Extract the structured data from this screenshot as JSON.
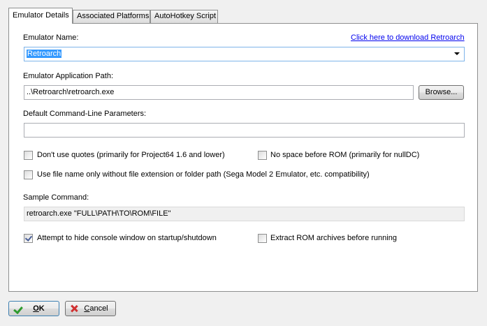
{
  "tabs": [
    {
      "label": "Emulator Details",
      "active": true
    },
    {
      "label": "Associated Platforms",
      "active": false
    },
    {
      "label": "AutoHotkey Script",
      "active": false
    }
  ],
  "emulator_name": {
    "label": "Emulator Name:",
    "value": "Retroarch",
    "download_link": "Click here to download Retroarch"
  },
  "app_path": {
    "label": "Emulator Application Path:",
    "value": "..\\Retroarch\\retroarch.exe",
    "browse_button": "Browse..."
  },
  "params": {
    "label": "Default Command-Line Parameters:",
    "value": ""
  },
  "options": {
    "no_quotes": {
      "label": "Don't use quotes (primarily for Project64 1.6 and lower)",
      "checked": false
    },
    "no_space": {
      "label": "No space before ROM (primarily for nullDC)",
      "checked": false
    },
    "file_name_only": {
      "label": "Use file name only without file extension or folder path (Sega Model 2 Emulator, etc. compatibility)",
      "checked": false
    },
    "hide_console": {
      "label": "Attempt to hide console window on startup/shutdown",
      "checked": true
    },
    "extract_rom": {
      "label": "Extract ROM archives before running",
      "checked": false
    }
  },
  "sample_command": {
    "label": "Sample Command:",
    "value": "retroarch.exe \"FULL\\PATH\\TO\\ROM\\FILE\""
  },
  "buttons": {
    "ok_accel": "O",
    "ok_rest": "K",
    "cancel_accel": "C",
    "cancel_rest": "ancel"
  },
  "colors": {
    "link": "#0000ee",
    "selection": "#3399ff",
    "ok_check": "#2e9a2e",
    "cancel_cross": "#d03030"
  }
}
